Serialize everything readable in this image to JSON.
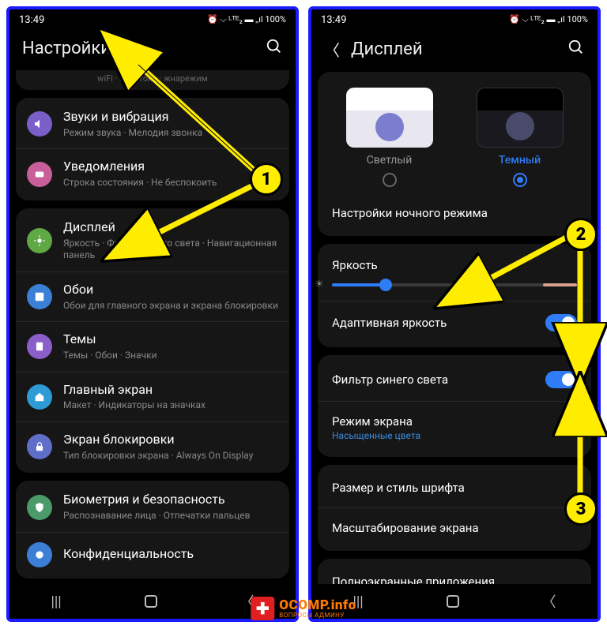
{
  "status": {
    "time": "13:49",
    "indicators": "⏰ ⌵ ᴸᵀᴱ₂ ▬ ₌ıl 100%"
  },
  "screen1": {
    "title": "Настройки",
    "truncated": "wiFi · блиеток ··· жнарежим",
    "items": [
      {
        "title": "Звуки и вибрация",
        "sub": "Режим звука · Мелодия звонка",
        "color": "#7b5fc9"
      },
      {
        "title": "Уведомления",
        "sub": "Строка состояния · Не беспокоить",
        "color": "#c95f9a"
      },
      {
        "title": "Дисплей",
        "sub": "Яркость · Фильтр синего света · Навигационная панель",
        "color": "#5fa845"
      },
      {
        "title": "Обои",
        "sub": "Обои для главного экрана и экрана блокировки",
        "color": "#3b7fd6"
      },
      {
        "title": "Темы",
        "sub": "Темы · Обои · Значки",
        "color": "#8a5fc9"
      },
      {
        "title": "Главный экран",
        "sub": "Макет · Индикаторы на значках",
        "color": "#2e9bd6"
      },
      {
        "title": "Экран блокировки",
        "sub": "Тип блокировки экрана · Always On Display",
        "color": "#5f6fc9"
      },
      {
        "title": "Биометрия и безопасность",
        "sub": "Распознавание лица · Отпечатки пальцев",
        "color": "#4a9a6a"
      },
      {
        "title": "Конфиденциальность",
        "sub": "",
        "color": "#3b7fd6"
      }
    ]
  },
  "screen2": {
    "title": "Дисплей",
    "themes": {
      "light": "Светлый",
      "dark": "Темный"
    },
    "nightMode": "Настройки ночного режима",
    "brightness": "Яркость",
    "adaptive": "Адаптивная яркость",
    "blueFilter": "Фильтр синего света",
    "screenMode": "Режим экрана",
    "screenModeSub": "Насыщенные цвета",
    "fontSize": "Размер и стиль шрифта",
    "scaling": "Масштабирование экрана",
    "fullscreen": "Полноэкранные приложения"
  },
  "badges": {
    "b1": "1",
    "b2": "2",
    "b3": "3"
  },
  "watermark": {
    "main": "OCOMP.info",
    "sub": "ВОПРОСЫ АДМИНУ"
  }
}
